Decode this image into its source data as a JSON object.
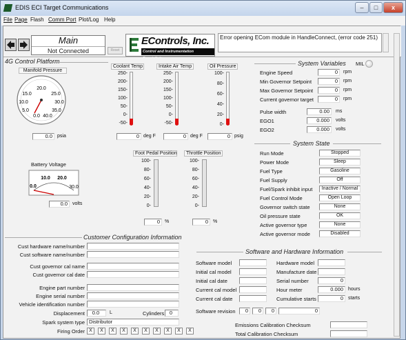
{
  "window": {
    "title": "EDIS ECI Target Communications",
    "minimize": "–",
    "maximize": "□",
    "close": "x"
  },
  "menu": {
    "items": [
      "File",
      "Page",
      "Flash",
      "Comm Port",
      "Plot/Log",
      "Help"
    ]
  },
  "toolbar": {
    "page_name": "Main",
    "connection_status": "Not Connected",
    "reset_label": "Reset",
    "logo_name": "EControls, Inc.",
    "logo_tagline": "Control and Instrumentation Specialists",
    "error_message": "Error opening ECom module in HandleConnect, (error code 251)"
  },
  "platform": {
    "title": "4G Control Platform"
  },
  "manifold": {
    "title": "Manifold Pressure",
    "dial_labels": [
      "20.0",
      "15.0",
      "25.0",
      "10.0",
      "30.0",
      "5.0",
      "35.0",
      "0.0",
      "40.0"
    ],
    "value": "0.0",
    "unit": "psia",
    "reading": 0
  },
  "coolant": {
    "title": "Coolant Temp",
    "ticks": [
      "250-",
      "200-",
      "150-",
      "100-",
      "50-",
      "0-",
      "-50-"
    ],
    "value": "0",
    "unit": "deg F"
  },
  "intake": {
    "title": "Intake Air Temp",
    "ticks": [
      "250-",
      "200-",
      "150-",
      "100-",
      "50-",
      "0-",
      "-50-"
    ],
    "value": "0",
    "unit": "deg F"
  },
  "oil": {
    "title": "Oil Pressure",
    "ticks": [
      "100-",
      "80-",
      "60-",
      "40-",
      "20-",
      "0-"
    ],
    "value": "0",
    "unit": "psig"
  },
  "battery": {
    "title": "Battery Voltage",
    "dial_labels": [
      "10.0",
      "20.0",
      "0.0",
      "30.0"
    ],
    "value": "0.0",
    "unit": "volts",
    "reading": 0
  },
  "pedal": {
    "title": "Foot Pedal Position",
    "ticks": [
      "100-",
      "80-",
      "60-",
      "40-",
      "20-",
      "0-"
    ],
    "value": "0",
    "unit": "%",
    "level": 0
  },
  "throttle": {
    "title": "Throttle Position",
    "ticks": [
      "100-",
      "80-",
      "60-",
      "40-",
      "20-",
      "0-"
    ],
    "value": "0",
    "unit": "%",
    "level": 0
  },
  "system_variables": {
    "title": "System Variables",
    "mil_label": "MIL",
    "rows": [
      {
        "label": "Engine Speed",
        "value": "0",
        "unit": "rpm"
      },
      {
        "label": "Min Governor Setpoint",
        "value": "0",
        "unit": "rpm"
      },
      {
        "label": "Max Governor Setpoint",
        "value": "0",
        "unit": "rpm"
      },
      {
        "label": "Current governor target",
        "value": "0",
        "unit": "rpm"
      }
    ],
    "rows2": [
      {
        "label": "Pulse width",
        "value": "0.00",
        "unit": "ms"
      },
      {
        "label": "EGO1",
        "value": "0.000",
        "unit": "volts"
      },
      {
        "label": "EGO2",
        "value": "0.000",
        "unit": "volts"
      }
    ]
  },
  "system_state": {
    "title": "System State",
    "rows": [
      {
        "label": "Run Mode",
        "value": "Stopped"
      },
      {
        "label": "Power Mode",
        "value": "Sleep"
      },
      {
        "label": "Fuel Type",
        "value": "Gasoline"
      },
      {
        "label": "Fuel Supply",
        "value": "Off"
      },
      {
        "label": "Fuel/Spark inhibit input",
        "value": "Inactive / Normal"
      },
      {
        "label": "Fuel Control Mode",
        "value": "Open Loop"
      },
      {
        "label": "Governor switch state",
        "value": "None"
      },
      {
        "label": "Oil pressure state",
        "value": "OK"
      },
      {
        "label": "Active governor type",
        "value": "None"
      },
      {
        "label": "Active governor mode",
        "value": "Disabled"
      }
    ]
  },
  "customer_config": {
    "title": "Customer Configuration Information",
    "rows": [
      {
        "label": "Cust hardware name/number",
        "value": ""
      },
      {
        "label": "Cust software name/number",
        "value": ""
      },
      {
        "label": "Cust governor cal name",
        "value": ""
      },
      {
        "label": "Cust governor cal date",
        "value": ""
      },
      {
        "label": "Engine part number",
        "value": ""
      },
      {
        "label": "Engine serial number",
        "value": ""
      },
      {
        "label": "Vehicle identification number",
        "value": ""
      }
    ],
    "displacement_label": "Displacement",
    "displacement_value": "0.0",
    "displacement_unit": "L",
    "cylinders_label": "Cylinders",
    "cylinders_value": "0",
    "spark_label": "Spark system type",
    "spark_value": "Distributor",
    "firing_label": "Firing Order",
    "firing_values": [
      "X",
      "X",
      "X",
      "X",
      "X",
      "X",
      "X",
      "X",
      "X",
      "X"
    ]
  },
  "software_hardware": {
    "title": "Software and Hardware Information",
    "left": [
      {
        "label": "Software model",
        "value": ""
      },
      {
        "label": "Initial cal model",
        "value": ""
      },
      {
        "label": "Initial cal date",
        "value": ""
      },
      {
        "label": "Current cal model",
        "value": ""
      },
      {
        "label": "Current cal date",
        "value": ""
      }
    ],
    "right": [
      {
        "label": "Hardware model",
        "value": "",
        "unit": ""
      },
      {
        "label": "Manufacture date",
        "value": "",
        "unit": ""
      },
      {
        "label": "Serial number",
        "value": "0",
        "unit": ""
      },
      {
        "label": "Hour meter",
        "value": "0.000",
        "unit": "hours"
      },
      {
        "label": "Cumulative starts",
        "value": "0",
        "unit": "starts"
      }
    ],
    "revision_label": "Software revision",
    "revision_values": [
      "0",
      "0",
      "0",
      "0"
    ],
    "emissions_label": "Emissions Calibration Checksum",
    "emissions_value": "",
    "total_label": "Total Calibration Checksum",
    "total_value": ""
  }
}
